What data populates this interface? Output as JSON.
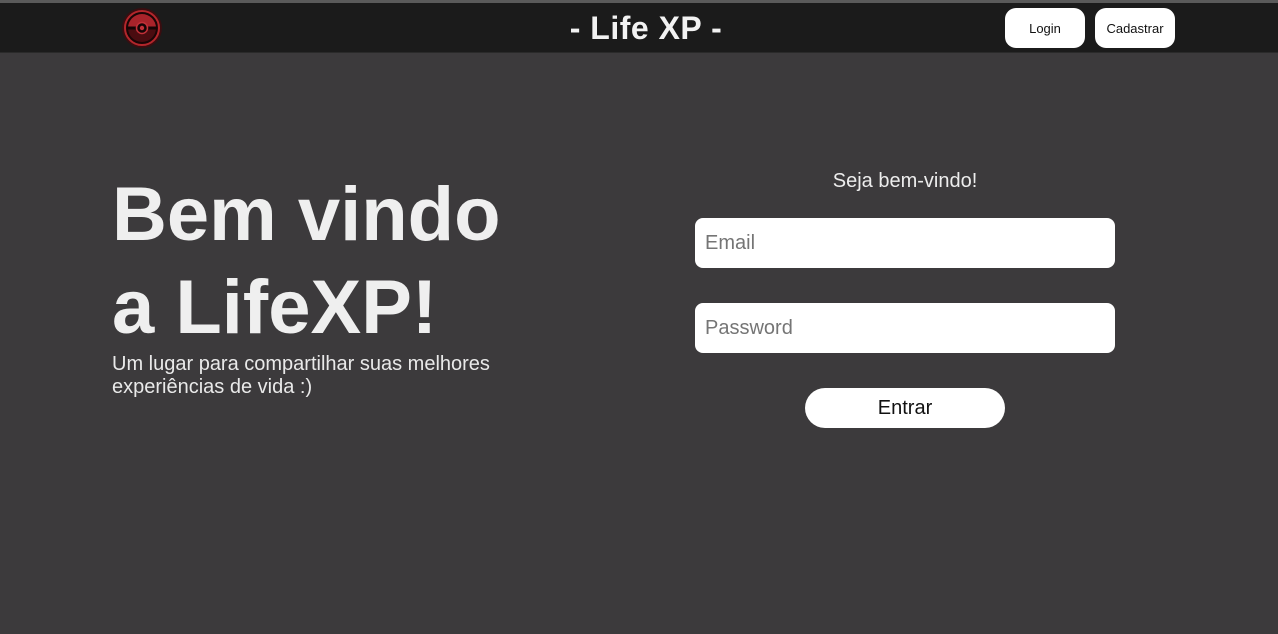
{
  "header": {
    "title": "- Life XP -",
    "logo_icon": "lifexp-logo-icon",
    "login_label": "Login",
    "signup_label": "Cadastrar"
  },
  "hero": {
    "heading_line1": "Bem vindo",
    "heading_line2": "a LifeXP!",
    "subtitle": "Um lugar para compartilhar suas melhores experiências de vida :)"
  },
  "login_form": {
    "welcome": "Seja bem-vindo!",
    "email_placeholder": "Email",
    "email_value": "",
    "password_placeholder": "Password",
    "password_value": "",
    "submit_label": "Entrar"
  },
  "colors": {
    "background": "#3c3a3c",
    "navbar": "#1b1b1b",
    "logo_red": "#b3262b",
    "button_bg": "#ffffff"
  }
}
